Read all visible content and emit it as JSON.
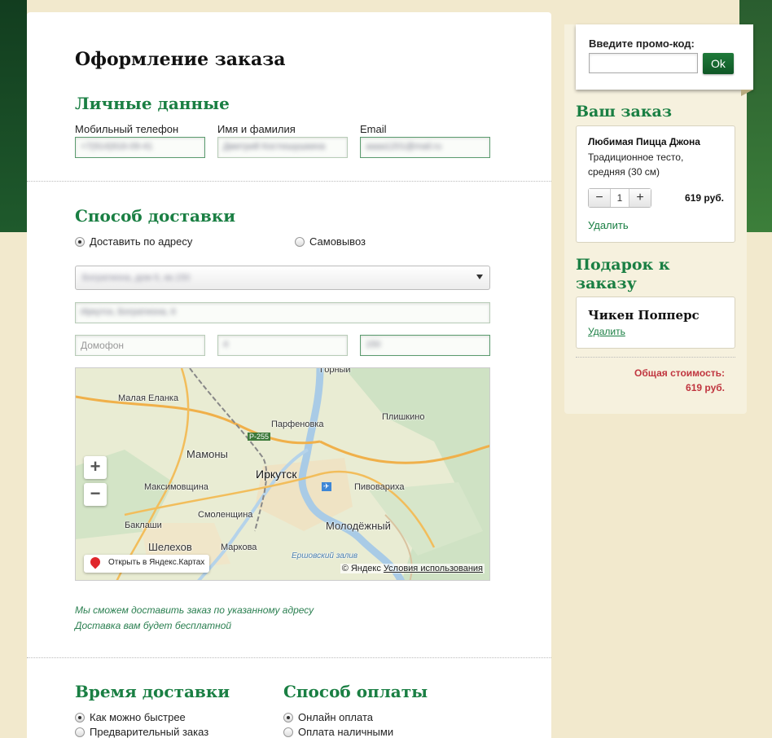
{
  "page": {
    "title": "Оформление заказа"
  },
  "personal": {
    "title": "Личные данные",
    "phone_label": "Мобильный телефон",
    "phone_value": "+7(914)916-09-41",
    "name_label": "Имя и фамилия",
    "name_value": "Дмитрий Костюшушкина",
    "email_label": "Email",
    "email_value": "aaaa1201@mail.ru"
  },
  "delivery": {
    "title": "Способ доставки",
    "option_address": "Доставить по адресу",
    "option_pickup": "Самовывоз",
    "address_select": "Богратиона, дом 6, кв.150",
    "address_line": "Иркутск, Богратиона, 6",
    "intercom_placeholder": "Домофон",
    "floor_value": "4",
    "apt_value": "150",
    "note_line1": "Мы сможем доставить заказ по указанному адресу",
    "note_line2": "Доставка вам будет бесплатной"
  },
  "map": {
    "labels": {
      "gorny": "Горный",
      "malaya_elanka": "Малая Еланка",
      "parfenovka": "Парфеновка",
      "plishkino": "Плишкино",
      "road": "Р-255",
      "mamony": "Мамоны",
      "irkutsk": "Иркутск",
      "maksimovshchina": "Максимовщина",
      "pivovarikha": "Пивовариха",
      "baklashi": "Баклаши",
      "smolenshchina": "Смоленщина",
      "molodezhny": "Молодёжный",
      "shelekhov": "Шелехов",
      "markova": "Маркова",
      "ershovsky": "Ершовский залив"
    },
    "zoom_in": "+",
    "zoom_out": "−",
    "open_in_yandex": "Открыть в Яндекс.Картах",
    "copyright": "© Яндекс",
    "terms": "Условия использования"
  },
  "time": {
    "title": "Время доставки",
    "option_asap": "Как можно быстрее",
    "option_preorder": "Предварительный заказ"
  },
  "payment": {
    "title": "Способ оплаты",
    "option_online": "Онлайн оплата",
    "option_cash": "Оплата наличными"
  },
  "promo": {
    "label": "Введите промо-код:",
    "value": "",
    "button": "Ok"
  },
  "order": {
    "title": "Ваш заказ",
    "item_name": "Любимая Пицца Джона",
    "item_desc1": "Традиционное тесто,",
    "item_desc2": "средняя (30 см)",
    "qty": "1",
    "minus": "−",
    "plus": "+",
    "price": "619 руб.",
    "remove": "Удалить"
  },
  "gift": {
    "title_line1": "Подарок к",
    "title_line2": "заказу",
    "item_name": "Чикен Попперс",
    "remove": "Удалить"
  },
  "total": {
    "label": "Общая стоимость:",
    "value": "619 руб."
  }
}
